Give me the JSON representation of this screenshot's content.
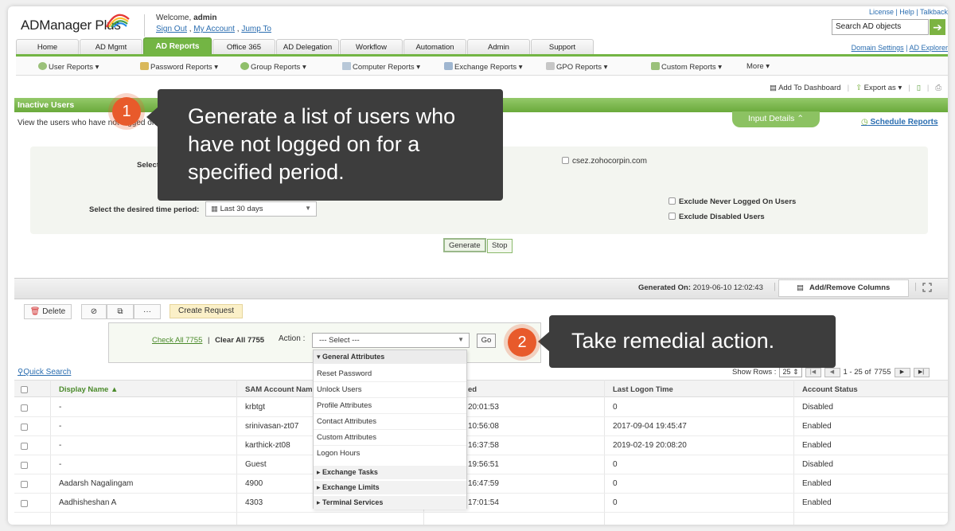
{
  "app": {
    "name": "ADManager Plus",
    "welcome_label": "Welcome,",
    "user": "admin",
    "sign_out": "Sign Out",
    "my_account": "My Account",
    "jump_to": "Jump To",
    "top_links": "License | Help | Talkback",
    "search_placeholder": "Search AD objects",
    "domain_settings": "Domain Settings",
    "ad_explorer": "AD Explorer"
  },
  "tabs": [
    "Home",
    "AD Mgmt",
    "AD Reports",
    "Office 365",
    "AD Delegation",
    "Workflow",
    "Automation",
    "Admin",
    "Support"
  ],
  "active_tab": "AD Reports",
  "submenu": [
    "User Reports ▾",
    "Password Reports ▾",
    "Group Reports ▾",
    "Computer Reports ▾",
    "Exchange Reports ▾",
    "GPO Reports ▾",
    "Custom Reports ▾",
    "More ▾"
  ],
  "toolbar": {
    "add_dashboard": "Add To Dashboard",
    "export": "Export as ▾"
  },
  "report": {
    "title": "Inactive Users",
    "description": "View the users who have not logged on",
    "input_details": "Input Details",
    "schedule": "Schedule Reports",
    "select_label": "Select",
    "domain": "csez.zohocorpin.com",
    "period_label": "Select the desired time period:",
    "period_value": "Last 30 days",
    "exclude_never": "Exclude Never Logged On Users",
    "exclude_disabled": "Exclude Disabled Users",
    "generate": "Generate",
    "stop": "Stop"
  },
  "results": {
    "generated_label": "Generated On:",
    "generated_value": "2019-06-10 12:02:43",
    "add_remove_columns": "Add/Remove Columns",
    "delete": "Delete",
    "more": "···",
    "create_request": "Create Request",
    "check_all": "Check All 7755",
    "clear_all": "Clear All 7755",
    "action_label": "Action :",
    "action_select": "--- Select ---",
    "go": "Go",
    "quick_search": "Quick Search",
    "show_rows_label": "Show Rows :",
    "show_rows_value": "25",
    "page_info": "1 - 25 of",
    "total": "7755"
  },
  "table": {
    "columns": [
      "Display Name ▲",
      "SAM Account Name",
      "ed",
      "Last Logon Time",
      "Account Status"
    ],
    "rows": [
      [
        "-",
        "krbtgt",
        "20:01:53",
        "0",
        "Disabled"
      ],
      [
        "-",
        "srinivasan-zt07",
        "10:56:08",
        "2017-09-04 19:45:47",
        "Enabled"
      ],
      [
        "-",
        "karthick-zt08",
        "16:37:58",
        "2019-02-19 20:08:20",
        "Enabled"
      ],
      [
        "-",
        "Guest",
        "19:56:51",
        "0",
        "Disabled"
      ],
      [
        "Aadarsh Nagalingam",
        "4900",
        "16:47:59",
        "0",
        "Enabled"
      ],
      [
        "Aadhisheshan A",
        "4303",
        "17:01:54",
        "0",
        "Enabled"
      ]
    ]
  },
  "dropdown": {
    "group_general": "General Attributes",
    "items": [
      "Reset Password",
      "Unlock Users",
      "Profile Attributes",
      "Contact Attributes",
      "Custom Attributes",
      "Logon Hours"
    ],
    "groups": [
      "Exchange Tasks",
      "Exchange Limits",
      "Terminal Services"
    ]
  },
  "callouts": {
    "one_num": "1",
    "one_text": "Generate a list of users who have not logged on for a specified period.",
    "two_num": "2",
    "two_text": "Take remedial action."
  },
  "colors": {
    "accent_green": "#73b544",
    "callout_bg": "#3d3d3d",
    "badge_orange": "#e85a2b",
    "link_blue": "#2a6db0"
  }
}
